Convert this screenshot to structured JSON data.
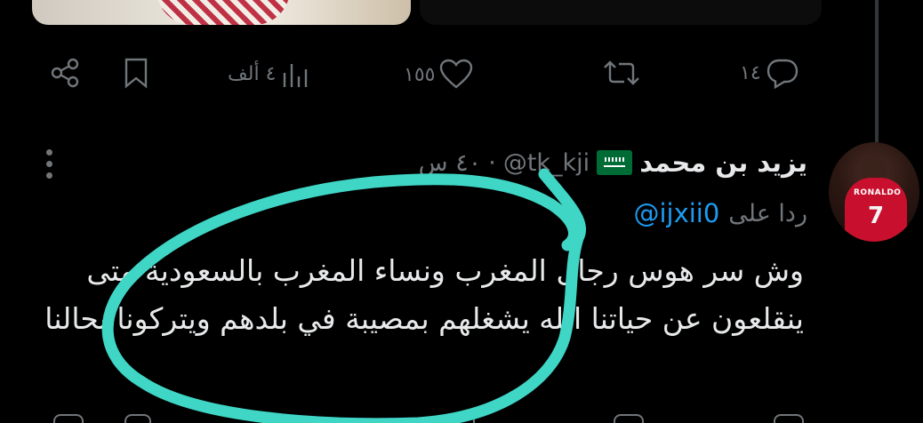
{
  "previous_tweet": {
    "actions": {
      "reply_count": "١٤",
      "like_count": "١٥٥",
      "view_count": "٤ ألف"
    }
  },
  "tweet": {
    "display_name": "يزيد بن محمد",
    "handle": "@tk_kji",
    "separator": "·",
    "time": "٤٠ س",
    "reply_prefix": "ردا على",
    "reply_to": "@ijxii0",
    "text": "وش سر هوس رجال المغرب ونساء المغرب بالسعودية متى ينقلعون عن حياتنا الله يشغلهم بمصيبة في بلدهم ويتركونا بحالنا"
  },
  "avatar": {
    "shirt_text": "RONALDO",
    "number": "7"
  },
  "icons": {
    "reply": "reply-icon",
    "retweet": "retweet-icon",
    "like": "heart-icon",
    "views": "views-icon",
    "bookmark": "bookmark-icon",
    "share": "share-icon",
    "more": "more-vertical-icon"
  },
  "colors": {
    "background": "#000000",
    "text": "#e7e9ea",
    "muted": "#71767b",
    "link": "#1d9bf0",
    "annotation": "#3fd6c6"
  }
}
